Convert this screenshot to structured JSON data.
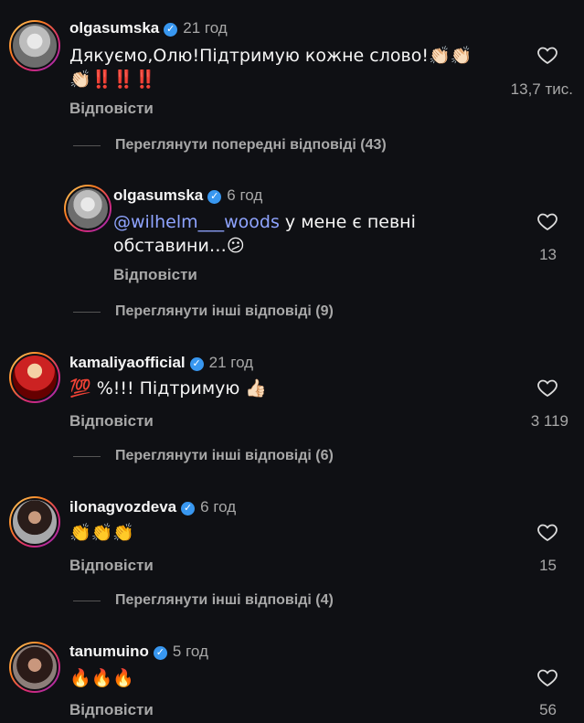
{
  "comments": [
    {
      "username": "olgasumska",
      "time": "21 год",
      "text_line1": "Дякуємо,Олю!Підтримую кожне слово!👏🏻👏🏻",
      "text_line2": "👏🏻‼️‼️‼️",
      "reply_label": "Відповісти",
      "likes": "13,7 тис.",
      "more_replies": "Переглянути попередні відповіді (43)"
    },
    {
      "username": "olgasumska",
      "time": "6 год",
      "mention": "@wilhelm___woods",
      "text_rest": " у мене є певні",
      "text_line2": "обставини…😕",
      "reply_label": "Відповісти",
      "likes": "13",
      "more_replies": "Переглянути інші відповіді (9)"
    },
    {
      "username": "kamaliyaofficial",
      "time": "21 год",
      "text": "💯 %!!! Підтримую 👍🏻",
      "reply_label": "Відповісти",
      "likes": "3 119",
      "more_replies": "Переглянути інші відповіді (6)"
    },
    {
      "username": "ilonagvozdeva",
      "time": "6 год",
      "text": "👏👏👏",
      "reply_label": "Відповісти",
      "likes": "15",
      "more_replies": "Переглянути інші відповіді (4)"
    },
    {
      "username": "tanumuino",
      "time": "5 год",
      "text": "🔥🔥🔥",
      "reply_label": "Відповісти",
      "likes": "56"
    }
  ],
  "icons": {
    "verified": "✓",
    "heart": "heart-outline-icon",
    "verified_color": "#3897f0"
  }
}
